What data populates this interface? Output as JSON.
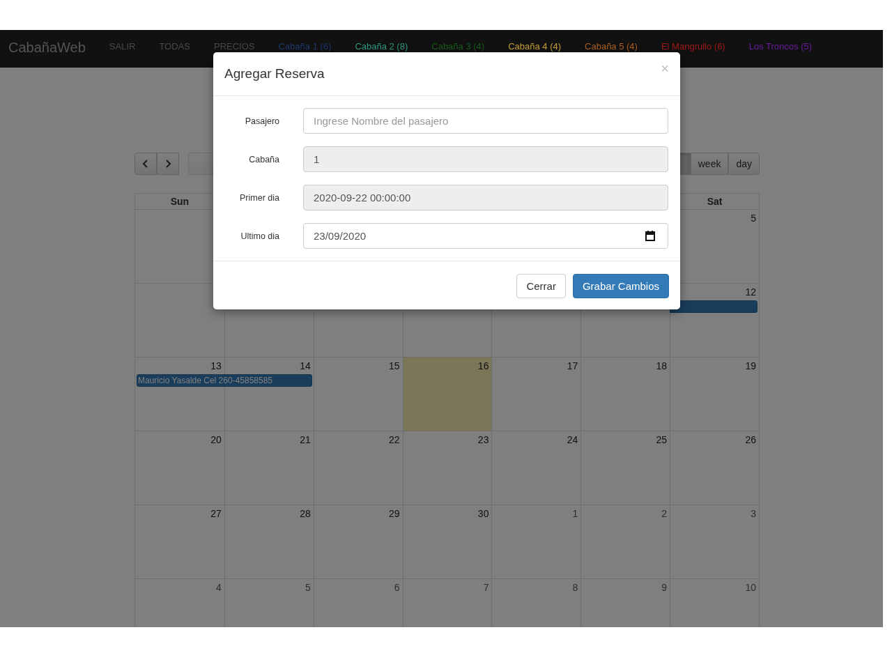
{
  "navbar": {
    "brand": "CabañaWeb",
    "links": [
      {
        "label": "SALIR",
        "color": "#4a4a4a"
      },
      {
        "label": "TODAS",
        "color": "#4a4a4a"
      },
      {
        "label": "PRECIOS",
        "color": "#4a4a4a"
      },
      {
        "label": "Cabaña 1 (6)",
        "color": "#1e3a6e"
      },
      {
        "label": "Cabaña 2 (8)",
        "color": "#2e9a7e"
      },
      {
        "label": "Cabaña 3 (4)",
        "color": "#1a5c1a"
      },
      {
        "label": "Cabaña 4 (4)",
        "color": "#c8a035"
      },
      {
        "label": "Cabaña 5 (4)",
        "color": "#b0601e"
      },
      {
        "label": "El Mangrullo (6)",
        "color": "#a01818"
      },
      {
        "label": "Los Troncos (5)",
        "color": "#6a1a9a"
      }
    ]
  },
  "calendar": {
    "nav_buttons": [
      {
        "kind": "prev"
      },
      {
        "kind": "next"
      },
      {
        "kind": "today"
      }
    ],
    "view_buttons": [
      {
        "selected": true
      },
      {
        "label": "week",
        "selected": false
      },
      {
        "label": "day",
        "selected": false
      }
    ],
    "weekdays": [
      "Sun",
      "Sat"
    ],
    "weeks": [
      {
        "days": [
          {
            "number": "5",
            "other_month": false,
            "today": false
          }
        ]
      },
      {
        "days": [
          {
            "number": "12",
            "other_month": false,
            "today": false,
            "event": {
              "starts": false,
              "ends": true
            }
          }
        ]
      },
      {
        "days": [
          {
            "number": "13",
            "other_month": false,
            "today": false,
            "event": {
              "starts": true,
              "text": "Mauricio Yasalde Cel 260-45858585"
            }
          },
          {
            "number": "14",
            "other_month": false,
            "today": false,
            "event": {
              "ends": true
            }
          },
          {
            "number": "15",
            "other_month": false,
            "today": false
          },
          {
            "number": "16",
            "other_month": false,
            "today": true
          },
          {
            "number": "17",
            "other_month": false,
            "today": false
          },
          {
            "number": "18",
            "other_month": false,
            "today": false
          },
          {
            "number": "19",
            "other_month": false,
            "today": false
          }
        ]
      },
      {
        "days": [
          {
            "number": "20",
            "other_month": false,
            "today": false
          },
          {
            "number": "21",
            "other_month": false,
            "today": false
          },
          {
            "number": "22",
            "other_month": false,
            "today": false
          },
          {
            "number": "23",
            "other_month": false,
            "today": false
          },
          {
            "number": "24",
            "other_month": false,
            "today": false
          },
          {
            "number": "25",
            "other_month": false,
            "today": false
          },
          {
            "number": "26",
            "other_month": false,
            "today": false
          }
        ]
      },
      {
        "days": [
          {
            "number": "27",
            "other_month": false,
            "today": false
          },
          {
            "number": "28",
            "other_month": false,
            "today": false
          },
          {
            "number": "29",
            "other_month": false,
            "today": false
          },
          {
            "number": "30",
            "other_month": false,
            "today": false
          },
          {
            "number": "1",
            "other_month": true,
            "today": false
          },
          {
            "number": "2",
            "other_month": true,
            "today": false
          },
          {
            "number": "3",
            "other_month": true,
            "today": false
          }
        ]
      },
      {
        "days": [
          {
            "number": "4",
            "other_month": true,
            "today": false
          },
          {
            "number": "5",
            "other_month": true,
            "today": false
          },
          {
            "number": "6",
            "other_month": true,
            "today": false
          },
          {
            "number": "7",
            "other_month": true,
            "today": false
          },
          {
            "number": "8",
            "other_month": true,
            "today": false
          },
          {
            "number": "9",
            "other_month": true,
            "today": false
          },
          {
            "number": "10",
            "other_month": true,
            "today": false
          }
        ]
      }
    ]
  },
  "modal": {
    "title": "Agregar Reserva",
    "close": "×",
    "fields": [
      {
        "label": "Pasajero",
        "placeholder": "Ingrese Nombre del pasajero",
        "disabled": false,
        "kind": "text"
      },
      {
        "label": "Cabaña",
        "value": "1",
        "disabled": true,
        "kind": "text"
      },
      {
        "label": "Primer dia",
        "value": "2020-09-22 00:00:00",
        "disabled": true,
        "kind": "text"
      },
      {
        "label": "Ultimo dia",
        "value": "23/09/2020",
        "disabled": false,
        "kind": "date"
      }
    ],
    "buttons": [
      {
        "label": "Cerrar",
        "kind": "default"
      },
      {
        "label": "Grabar Cambios",
        "kind": "primary"
      }
    ]
  }
}
